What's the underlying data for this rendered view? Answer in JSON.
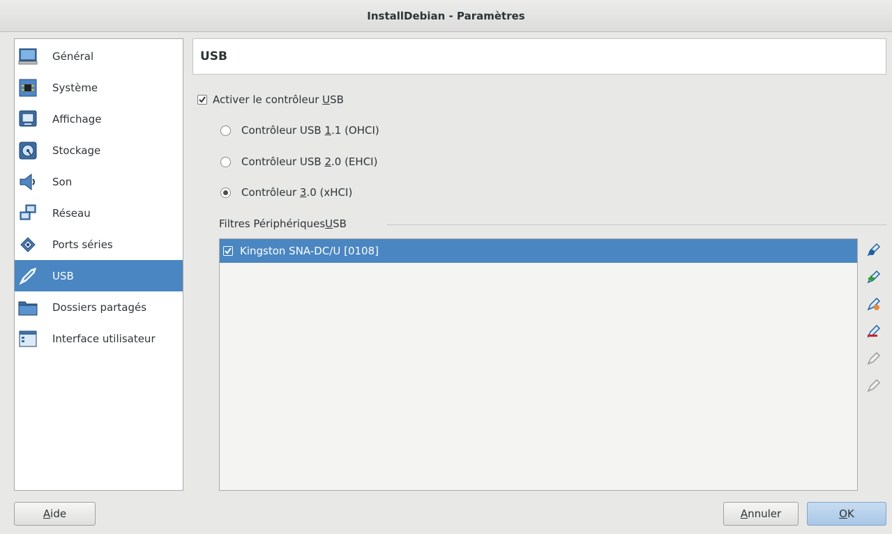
{
  "window": {
    "title": "InstallDebian - Paramètres"
  },
  "sidebar": {
    "items": [
      {
        "label": "Général",
        "icon": "general-icon"
      },
      {
        "label": "Système",
        "icon": "system-icon"
      },
      {
        "label": "Affichage",
        "icon": "display-icon"
      },
      {
        "label": "Stockage",
        "icon": "storage-icon"
      },
      {
        "label": "Son",
        "icon": "sound-icon"
      },
      {
        "label": "Réseau",
        "icon": "network-icon"
      },
      {
        "label": "Ports séries",
        "icon": "serial-ports-icon"
      },
      {
        "label": "USB",
        "icon": "usb-icon",
        "selected": true
      },
      {
        "label": "Dossiers partagés",
        "icon": "shared-folders-icon"
      },
      {
        "label": "Interface utilisateur",
        "icon": "user-interface-icon"
      }
    ]
  },
  "panel": {
    "title": "USB",
    "enable_usb": {
      "label_pre": "Activer le contrôleur ",
      "label_mnemonic": "U",
      "label_post": "SB",
      "checked": true
    },
    "controllers": [
      {
        "pre": "Contrôleur USB ",
        "mnemonic": "1",
        "post": ".1 (OHCI)",
        "selected": false
      },
      {
        "pre": "Contrôleur USB ",
        "mnemonic": "2",
        "post": ".0 (EHCI)",
        "selected": false
      },
      {
        "pre": "Contrôleur ",
        "mnemonic": "3",
        "post": ".0 (xHCI)",
        "selected": true
      }
    ],
    "filters_group": {
      "pre": "Filtres Périphériques ",
      "mnemonic": "U",
      "post": "SB"
    },
    "filters": [
      {
        "label": "Kingston SNA-DC/U [0108]",
        "checked": true
      }
    ],
    "tools": [
      {
        "icon": "add-filter-icon",
        "enabled": true
      },
      {
        "icon": "add-from-device-icon",
        "enabled": true
      },
      {
        "icon": "edit-filter-icon",
        "enabled": true
      },
      {
        "icon": "remove-filter-icon",
        "enabled": true
      },
      {
        "icon": "move-up-icon",
        "enabled": false
      },
      {
        "icon": "move-down-icon",
        "enabled": false
      }
    ]
  },
  "buttons": {
    "help": {
      "mnemonic": "A",
      "rest": "ide"
    },
    "cancel": {
      "mnemonic": "A",
      "rest": "nnuler"
    },
    "ok": {
      "mnemonic": "O",
      "rest": "K"
    }
  },
  "colors": {
    "selection": "#4a86c1",
    "accent_ok": "#b3d0ec"
  }
}
